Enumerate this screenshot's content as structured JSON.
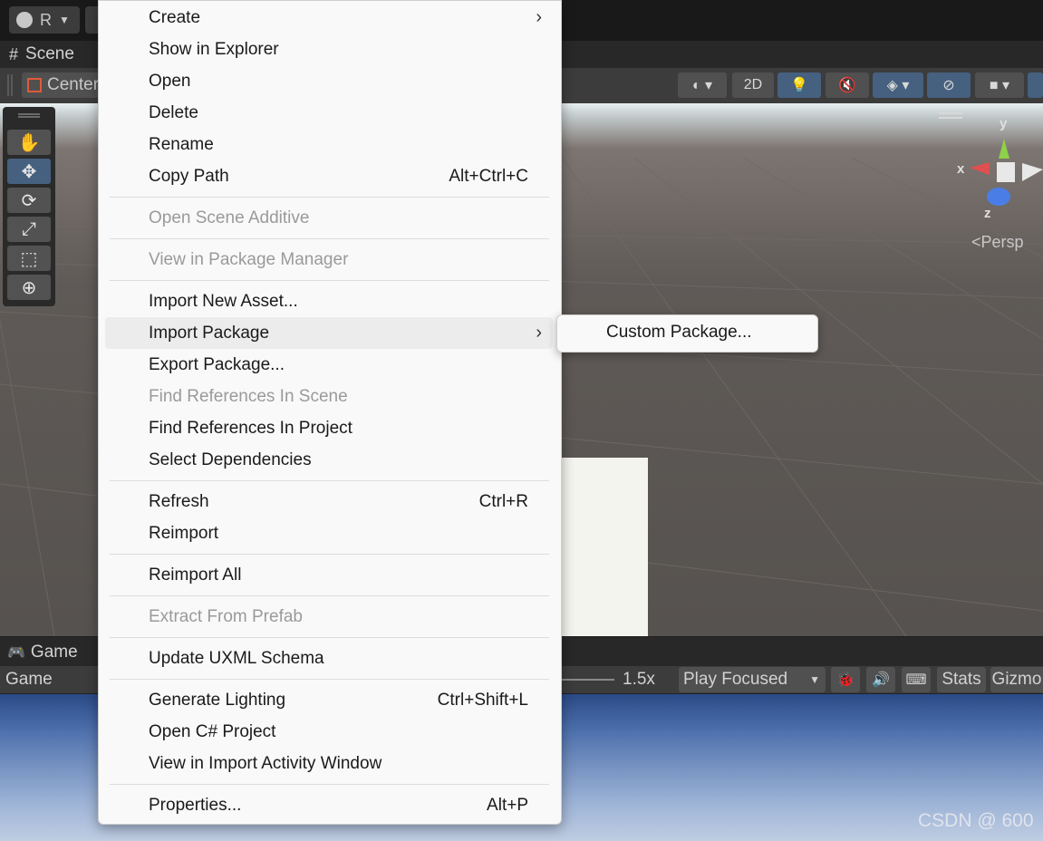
{
  "topbar": {
    "account_label": "R"
  },
  "scene": {
    "tab_title": "Scene",
    "pivot_label": "Center",
    "btn_2d": "2D",
    "persp_label": "Persp",
    "axis_x": "x",
    "axis_y": "y",
    "axis_z": "z"
  },
  "game": {
    "tab_title": "Game",
    "display_label": "Game",
    "scale_value": "1.5x",
    "play_mode": "Play Focused",
    "stats_label": "Stats",
    "gizmos_label": "Gizmo"
  },
  "context_menu": {
    "items": [
      {
        "label": "Create",
        "shortcut": "",
        "submenu": "›",
        "disabled": false
      },
      {
        "label": "Show in Explorer",
        "shortcut": "",
        "submenu": "",
        "disabled": false
      },
      {
        "label": "Open",
        "shortcut": "",
        "submenu": "",
        "disabled": false
      },
      {
        "label": "Delete",
        "shortcut": "",
        "submenu": "",
        "disabled": false
      },
      {
        "label": "Rename",
        "shortcut": "",
        "submenu": "",
        "disabled": false
      },
      {
        "label": "Copy Path",
        "shortcut": "Alt+Ctrl+C",
        "submenu": "",
        "disabled": false
      },
      {
        "label": "Open Scene Additive",
        "shortcut": "",
        "submenu": "",
        "disabled": true
      },
      {
        "label": "View in Package Manager",
        "shortcut": "",
        "submenu": "",
        "disabled": true
      },
      {
        "label": "Import New Asset...",
        "shortcut": "",
        "submenu": "",
        "disabled": false
      },
      {
        "label": "Import Package",
        "shortcut": "",
        "submenu": "›",
        "disabled": false
      },
      {
        "label": "Export Package...",
        "shortcut": "",
        "submenu": "",
        "disabled": false
      },
      {
        "label": "Find References In Scene",
        "shortcut": "",
        "submenu": "",
        "disabled": true
      },
      {
        "label": "Find References In Project",
        "shortcut": "",
        "submenu": "",
        "disabled": false
      },
      {
        "label": "Select Dependencies",
        "shortcut": "",
        "submenu": "",
        "disabled": false
      },
      {
        "label": "Refresh",
        "shortcut": "Ctrl+R",
        "submenu": "",
        "disabled": false
      },
      {
        "label": "Reimport",
        "shortcut": "",
        "submenu": "",
        "disabled": false
      },
      {
        "label": "Reimport All",
        "shortcut": "",
        "submenu": "",
        "disabled": false
      },
      {
        "label": "Extract From Prefab",
        "shortcut": "",
        "submenu": "",
        "disabled": true
      },
      {
        "label": "Update UXML Schema",
        "shortcut": "",
        "submenu": "",
        "disabled": false
      },
      {
        "label": "Generate Lighting",
        "shortcut": "Ctrl+Shift+L",
        "submenu": "",
        "disabled": false
      },
      {
        "label": "Open C# Project",
        "shortcut": "",
        "submenu": "",
        "disabled": false
      },
      {
        "label": "View in Import Activity Window",
        "shortcut": "",
        "submenu": "",
        "disabled": false
      },
      {
        "label": "Properties...",
        "shortcut": "Alt+P",
        "submenu": "",
        "disabled": false
      }
    ]
  },
  "submenu": {
    "items": [
      {
        "label": "Custom Package..."
      }
    ]
  },
  "watermark": "CSDN @ 600"
}
